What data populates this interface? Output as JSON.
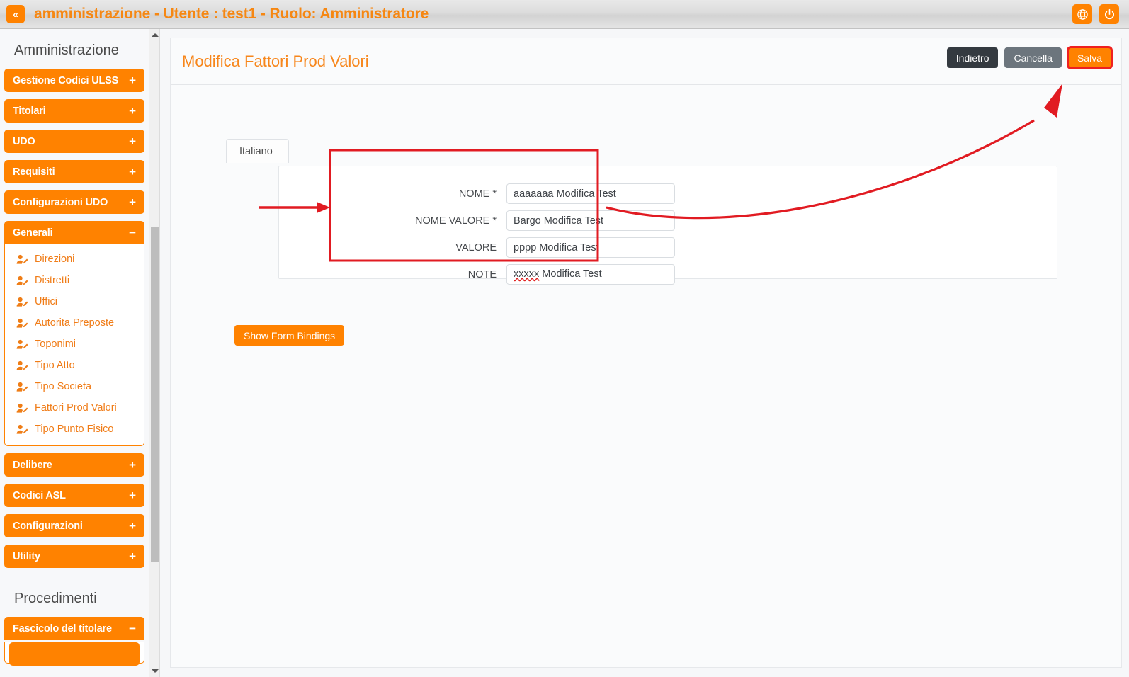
{
  "topbar": {
    "collapse_label": "«",
    "title": "amministrazione - Utente : test1 - Ruolo: Amministratore",
    "language_icon": "globe-icon",
    "power_icon": "power-icon"
  },
  "sidebar": {
    "heading_admin": "Amministrazione",
    "heading_procedures": "Procedimenti",
    "plus": "+",
    "minus": "−",
    "groups": [
      {
        "label": "Gestione Codici ULSS",
        "state": "collapsed"
      },
      {
        "label": "Titolari",
        "state": "collapsed"
      },
      {
        "label": "UDO",
        "state": "collapsed"
      },
      {
        "label": "Requisiti",
        "state": "collapsed"
      },
      {
        "label": "Configurazioni UDO",
        "state": "collapsed"
      },
      {
        "label": "Generali",
        "state": "expanded"
      }
    ],
    "generali_items": [
      {
        "label": "Direzioni"
      },
      {
        "label": "Distretti"
      },
      {
        "label": "Uffici"
      },
      {
        "label": "Autorita Preposte"
      },
      {
        "label": "Toponimi"
      },
      {
        "label": "Tipo Atto"
      },
      {
        "label": "Tipo Societa"
      },
      {
        "label": "Fattori Prod Valori"
      },
      {
        "label": "Tipo Punto Fisico"
      }
    ],
    "groups_after": [
      {
        "label": "Delibere",
        "state": "collapsed"
      },
      {
        "label": "Codici ASL",
        "state": "collapsed"
      },
      {
        "label": "Configurazioni",
        "state": "collapsed"
      },
      {
        "label": "Utility",
        "state": "collapsed"
      }
    ],
    "procedure_groups": [
      {
        "label": "Fascicolo del titolare",
        "state": "expanded"
      }
    ]
  },
  "page": {
    "title": "Modifica Fattori Prod Valori",
    "buttons": {
      "back": "Indietro",
      "cancel": "Cancella",
      "save": "Salva"
    },
    "tab": "Italiano",
    "show_bindings": "Show Form Bindings"
  },
  "form": {
    "fields": [
      {
        "label": "NOME *",
        "value": "aaaaaaa Modifica Test"
      },
      {
        "label": "NOME VALORE *",
        "value": "Bargo Modifica Test"
      },
      {
        "label": "VALORE",
        "value": "pppp Modifica Test"
      },
      {
        "label": "NOTE",
        "value_misspelled": "xxxxx",
        "value_rest": " Modifica Test"
      }
    ]
  },
  "colors": {
    "accent_orange": "#ff8200",
    "title_orange": "#f68712",
    "annotation_red": "#e11b22",
    "dark_button": "#343a40",
    "gray_button": "#6c757d"
  }
}
